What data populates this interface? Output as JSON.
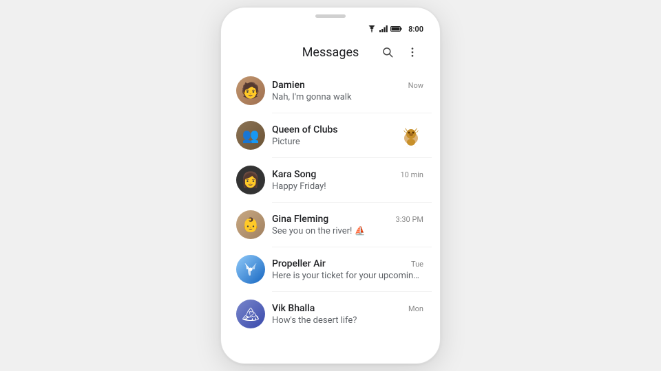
{
  "phone": {
    "status_bar": {
      "time": "8:00"
    },
    "app_bar": {
      "title": "Messages",
      "search_label": "Search",
      "more_label": "More options"
    },
    "conversations": [
      {
        "id": "damien",
        "name": "Damien",
        "preview": "Nah, I'm gonna walk",
        "time": "Now",
        "avatar_color": "av-damien",
        "avatar_emoji": "👩",
        "has_thumb": false
      },
      {
        "id": "queen-of-clubs",
        "name": "Queen of Clubs",
        "preview": "Picture",
        "time": "",
        "avatar_color": "av-queen",
        "avatar_emoji": "👥",
        "has_thumb": true,
        "thumb_emoji": "🦁"
      },
      {
        "id": "kara-song",
        "name": "Kara Song",
        "preview": "Happy Friday!",
        "time": "10 min",
        "avatar_color": "av-kara",
        "avatar_emoji": "👩",
        "has_thumb": false
      },
      {
        "id": "gina-fleming",
        "name": "Gina Fleming",
        "preview": "See you on the river! ⛵",
        "time": "3:30 PM",
        "avatar_color": "av-gina",
        "avatar_emoji": "👶",
        "has_thumb": false
      },
      {
        "id": "propeller-air",
        "name": "Propeller Air",
        "preview": "Here is your ticket for your upcoming...",
        "time": "Tue",
        "avatar_color": "av-propeller",
        "avatar_emoji": "✈",
        "has_thumb": false
      },
      {
        "id": "vik-bhalla",
        "name": "Vik Bhalla",
        "preview": "How's the desert life?",
        "time": "Mon",
        "avatar_color": "av-vik",
        "avatar_emoji": "🏔",
        "has_thumb": false
      }
    ]
  }
}
